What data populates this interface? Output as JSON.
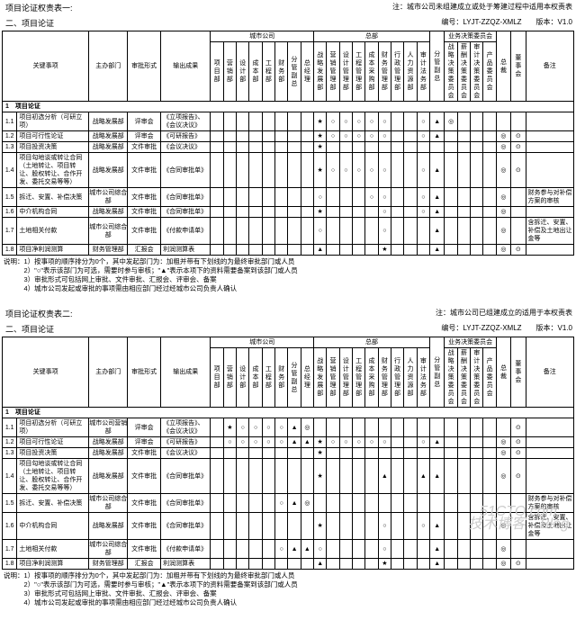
{
  "t1": {
    "title_left_line1": "项目论证权责表一:",
    "title_left_line2": "二、项目论证",
    "note_right": "注：城市公司未组建成立或处于筹建过程中适用本权责表",
    "code": "编号：LYJT-ZZQZ-XMLZ",
    "ver": "版本：V1.0",
    "h": {
      "key": "关键事项",
      "dept": "主办部门",
      "mode": "审批形式",
      "out": "输出成果",
      "g_city": "城市公司",
      "g_hq": "总部",
      "g_biz": "业务决策委员会",
      "fgfz": "分管副总",
      "zcw": "总裁",
      "dsh": "董事会",
      "rem": "备注",
      "c": [
        "项目部",
        "营销部",
        "设计部",
        "成本部",
        "工程部",
        "财务部",
        "分管副总",
        "总经理",
        "战略发展部",
        "营销管理部",
        "设计管理部",
        "工程管理部",
        "成本采购部",
        "财务管理部",
        "行政管理部",
        "人力资源部",
        "审计法务部"
      ],
      "biz": [
        "战略决策委员会",
        "薪酬决策委员会",
        "审计决策委员会",
        "产品委员会"
      ]
    },
    "sec": "1　项目论证",
    "rows": [
      {
        "no": "1.1",
        "k": "项目初选分析（可研立项）",
        "d": "战略发展部",
        "m": "评审会",
        "o": "《立项报告》、《会议决议》",
        "c": [
          "",
          "",
          "",
          "",
          "",
          "",
          "",
          "",
          "★",
          "○",
          "○",
          "○",
          "○",
          "○",
          "",
          "",
          "○"
        ],
        "f": "▲",
        "b": [
          "◎",
          "",
          "",
          ""
        ],
        "z": "",
        "ds": "",
        "r": ""
      },
      {
        "no": "1.2",
        "k": "项目可行性论证",
        "d": "战略发展部",
        "m": "评审会",
        "o": "《可研报告》",
        "c": [
          "",
          "",
          "",
          "",
          "",
          "",
          "",
          "",
          "★",
          "○",
          "○",
          "○",
          "○",
          "○",
          "",
          "",
          "○"
        ],
        "f": "▲",
        "b": [
          "",
          "",
          "",
          ""
        ],
        "z": "◎",
        "ds": "⊙",
        "r": ""
      },
      {
        "no": "1.3",
        "k": "项目投资决策",
        "d": "战略发展部",
        "m": "文件审批",
        "o": "《会议决议》",
        "c": [
          "",
          "",
          "",
          "",
          "",
          "",
          "",
          "",
          "★",
          "",
          "",
          "",
          "",
          "",
          "",
          "",
          ""
        ],
        "f": "",
        "b": [
          "",
          "",
          "",
          ""
        ],
        "z": "◎",
        "ds": "⊙",
        "r": ""
      },
      {
        "no": "1.4",
        "k": "项目勾地谈或转让合同（土地转让、项目转让、股权转让、合作开发、委托交易等等）",
        "d": "战略发展部",
        "m": "文件审批",
        "o": "《合同审批单》",
        "c": [
          "",
          "",
          "",
          "",
          "",
          "",
          "",
          "",
          "★",
          "○",
          "○",
          "○",
          "○",
          "○",
          "",
          "",
          "○"
        ],
        "f": "▲",
        "b": [
          "",
          "",
          "",
          ""
        ],
        "z": "◎",
        "ds": "⊙",
        "r": ""
      },
      {
        "no": "1.5",
        "k": "拆迁、安置、补偿决策",
        "d": "城市公司综合部",
        "m": "文件审批",
        "o": "《合同审批单》",
        "c": [
          "",
          "",
          "",
          "",
          "",
          "",
          "",
          "",
          "○",
          "",
          "",
          "",
          "○",
          "○",
          "",
          "",
          "○"
        ],
        "f": "▲",
        "b": [
          "",
          "",
          "",
          ""
        ],
        "z": "◎",
        "ds": "",
        "r": "财务参与对补偿方案的审核"
      },
      {
        "no": "1.6",
        "k": "中介机构合同",
        "d": "战略发展部",
        "m": "文件审批",
        "o": "《合同审批单》",
        "c": [
          "",
          "",
          "",
          "",
          "",
          "",
          "",
          "",
          "★",
          "",
          "",
          "",
          "",
          "○",
          "",
          "",
          "○"
        ],
        "f": "▲",
        "b": [
          "",
          "",
          "",
          ""
        ],
        "z": "◎",
        "ds": "",
        "r": ""
      },
      {
        "no": "1.7",
        "k": "土地相关付款",
        "d": "城市公司综合部",
        "m": "文件审批",
        "o": "《付款申请单》",
        "c": [
          "",
          "",
          "",
          "",
          "",
          "",
          "",
          "",
          "○",
          "",
          "",
          "",
          "",
          "○",
          "",
          "",
          ""
        ],
        "f": "▲",
        "b": [
          "",
          "",
          "",
          ""
        ],
        "z": "◎",
        "ds": "",
        "r": "含拆迁、安置、补偿及土地出让金等"
      },
      {
        "no": "1.8",
        "k": "项目净利润测算",
        "d": "财务管理部",
        "m": "汇报会",
        "o": "利润测算表",
        "c": [
          "",
          "",
          "",
          "",
          "",
          "",
          "",
          "",
          "▲",
          "",
          "",
          "",
          "",
          "★",
          "",
          "",
          ""
        ],
        "f": "▲",
        "b": [
          "",
          "",
          "",
          ""
        ],
        "z": "◎",
        "ds": "⊙",
        "r": ""
      }
    ],
    "notes": [
      "说明：1）按事项的顺序排分为0个，其中发起部门为：加粗并带有下划线的为最终审批部门或人员",
      "　　　2）\"○\"表示该部门为可选，需要时参与审核；\"▲\"表示本项下的资料需要备案到该部门或人员",
      "　　　3）审批形式可包括网上审批、文件审批、汇报会、评审会、备案",
      "　　　4）城市公司发起或审批的事项需由相应部门经过经城市公司负责人确认"
    ]
  },
  "t2": {
    "title_left_line1": "项目论证权责表二:",
    "title_left_line2": "二、项目论证",
    "note_right": "注：城市公司已组建成立的适用于本权责表",
    "code": "编号：LYJT-ZZQZ-XMLZ",
    "ver": "版本：V1.0",
    "h": {
      "key": "关键事项",
      "dept": "主办部门",
      "mode": "审批形式",
      "out": "输出成果",
      "g_city": "城市公司",
      "g_hq": "总部",
      "g_biz": "业务决策委员会",
      "fgfz": "分管副总",
      "zcw": "总裁",
      "dsh": "董事会",
      "rem": "备注",
      "c": [
        "项目部",
        "营销部",
        "设计部",
        "成本部",
        "工程部",
        "财务部",
        "分管副总",
        "总经理",
        "战略发展部",
        "营销管理部",
        "设计管理部",
        "工程管理部",
        "成本采购部",
        "财务管理部",
        "行政管理部",
        "人力资源部",
        "审计法务部"
      ],
      "biz": [
        "战略决策委员会",
        "薪酬决策委员会",
        "审计决策委员会",
        "产品委员会"
      ]
    },
    "sec": "1　项目论证",
    "rows": [
      {
        "no": "1.1",
        "k": "项目初选分析（可研立项）",
        "d": "城市公司营销部",
        "m": "评审会",
        "o": "《立项报告》、《会议决议》",
        "c": [
          "",
          "★",
          "○",
          "○",
          "○",
          "○",
          "▲",
          "◎",
          "",
          "",
          "",
          "",
          "",
          "",
          "",
          "",
          ""
        ],
        "f": "",
        "b": [
          "",
          "",
          "",
          ""
        ],
        "z": "",
        "ds": "⊙",
        "r": ""
      },
      {
        "no": "1.2",
        "k": "项目可行性论证",
        "d": "战略发展部",
        "m": "评审会",
        "o": "《可研报告》",
        "c": [
          "",
          "○",
          "○",
          "○",
          "○",
          "○",
          "▲",
          "▲",
          "★",
          "○",
          "○",
          "○",
          "○",
          "○",
          "",
          "",
          "○"
        ],
        "f": "▲",
        "b": [
          "",
          "",
          "",
          ""
        ],
        "z": "◎",
        "ds": "⊙",
        "r": ""
      },
      {
        "no": "1.3",
        "k": "项目投资决策",
        "d": "战略发展部",
        "m": "文件审批",
        "o": "《会议决议》",
        "c": [
          "",
          "",
          "",
          "",
          "",
          "",
          "",
          "",
          "★",
          "",
          "",
          "",
          "",
          "",
          "",
          "",
          ""
        ],
        "f": "",
        "b": [
          "",
          "",
          "",
          ""
        ],
        "z": "◎",
        "ds": "⊙",
        "r": ""
      },
      {
        "no": "1.4",
        "k": "项目勾地谈或转让合同（土地转让、项目转让、股权转让、合作开发、委托交易等等）",
        "d": "战略发展部",
        "m": "文件审批",
        "o": "《合同审批单》",
        "c": [
          "",
          "",
          "",
          "",
          "",
          "",
          "",
          "",
          "★",
          "",
          "",
          "",
          "",
          "▲",
          "",
          "",
          "▲"
        ],
        "f": "▲",
        "b": [
          "",
          "",
          "",
          ""
        ],
        "z": "◎",
        "ds": "⊙",
        "r": ""
      },
      {
        "no": "1.5",
        "k": "拆迁、安置、补偿决策",
        "d": "城市公司综合部",
        "m": "文件审批",
        "o": "《合同审批单》",
        "c": [
          "",
          "",
          "",
          "",
          "",
          "○",
          "▲",
          "◎",
          "",
          "",
          "",
          "",
          "",
          "",
          "",
          "",
          ""
        ],
        "f": "",
        "b": [
          "",
          "",
          "",
          ""
        ],
        "z": "",
        "ds": "",
        "r": "财务参与对补偿方案的审核"
      },
      {
        "no": "1.6",
        "k": "中介机构合同",
        "d": "战略发展部",
        "m": "文件审批",
        "o": "《合同审批单》",
        "c": [
          "",
          "",
          "",
          "",
          "",
          "",
          "",
          "",
          "★",
          "",
          "",
          "",
          "",
          "○",
          "",
          "",
          "○"
        ],
        "f": "▲",
        "b": [
          "",
          "",
          "",
          ""
        ],
        "z": "◎",
        "ds": "",
        "r": "含拆迁、安置、补偿及土地出让金等"
      },
      {
        "no": "1.7",
        "k": "土地相关付款",
        "d": "城市公司综合部",
        "m": "文件审批",
        "o": "《付款申请单》",
        "c": [
          "",
          "",
          "",
          "",
          "",
          "○",
          "▲",
          "▲",
          "○",
          "",
          "",
          "",
          "",
          "○",
          "",
          "",
          ""
        ],
        "f": "▲",
        "b": [
          "",
          "",
          "",
          ""
        ],
        "z": "◎",
        "ds": "",
        "r": ""
      },
      {
        "no": "1.8",
        "k": "项目净利润测算",
        "d": "财务管理部",
        "m": "汇报会",
        "o": "利润测算表",
        "c": [
          "",
          "",
          "",
          "",
          "",
          "",
          "",
          "",
          "▲",
          "",
          "",
          "",
          "",
          "★",
          "",
          "",
          ""
        ],
        "f": "▲",
        "b": [
          "",
          "",
          "",
          ""
        ],
        "z": "◎",
        "ds": "⊙",
        "r": ""
      }
    ],
    "notes": [
      "说明：1）按事项的顺序排分为0个，其中发起部门为：加粗并带有下划线的为最终审批部门或人员",
      "　　　2）\"○\"表示该部门为可选，需要时参与审核；\"▲\"表示本项下的资料需要备案到该部门或人员",
      "　　　3）审批形式可包括网上审批、文件审批、汇报会、评审会、备案",
      "　　　4）城市公司发起或审批的事项需由相应部门经过经城市公司负责人确认"
    ]
  },
  "wm": {
    "l1": "51CTO.com",
    "l2": "技术博客　Blog"
  }
}
